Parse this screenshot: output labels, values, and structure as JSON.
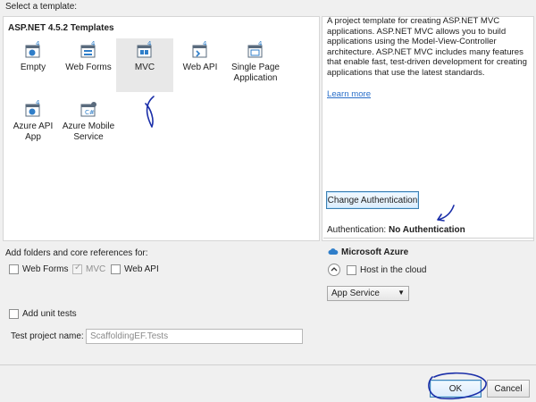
{
  "header": {
    "select_label": "Select a template:"
  },
  "templates": {
    "group_title": "ASP.NET 4.5.2 Templates",
    "items": [
      {
        "label": "Empty",
        "icon": "empty-template-icon"
      },
      {
        "label": "Web Forms",
        "icon": "webforms-template-icon"
      },
      {
        "label": "MVC",
        "icon": "mvc-template-icon",
        "selected": true
      },
      {
        "label": "Web API",
        "icon": "webapi-template-icon"
      },
      {
        "label": "Single Page Application",
        "icon": "spa-template-icon"
      },
      {
        "label": "Azure API App",
        "icon": "azure-api-template-icon"
      },
      {
        "label": "Azure Mobile Service",
        "icon": "azure-mobile-template-icon"
      }
    ]
  },
  "description": {
    "text": "A project template for creating ASP.NET MVC applications. ASP.NET MVC allows you to build applications using the Model-View-Controller architecture. ASP.NET MVC includes many features that enable fast, test-driven development for creating applications that use the latest standards.",
    "learn_more": "Learn more"
  },
  "auth": {
    "change_button": "Change Authentication",
    "label": "Authentication:",
    "value": "No Authentication"
  },
  "azure": {
    "title": "Microsoft Azure",
    "host_label": "Host in the cloud",
    "service": "App Service"
  },
  "references": {
    "title": "Add folders and core references for:",
    "webforms": "Web Forms",
    "mvc": "MVC",
    "webapi": "Web API"
  },
  "tests": {
    "add_label": "Add unit tests",
    "project_label": "Test project name:",
    "project_name": "ScaffoldingEF.Tests"
  },
  "footer": {
    "ok": "OK",
    "cancel": "Cancel"
  }
}
